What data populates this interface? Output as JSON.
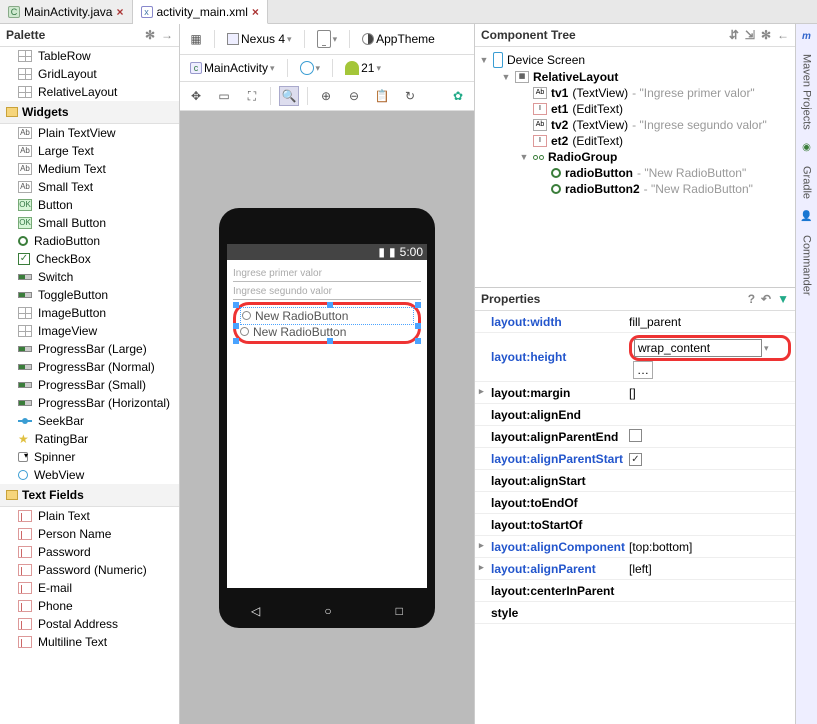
{
  "tabs": [
    {
      "label": "MainActivity.java",
      "active": false
    },
    {
      "label": "activity_main.xml",
      "active": true
    }
  ],
  "palette": {
    "title": "Palette",
    "groups": [
      {
        "type": "item",
        "icon": "grid",
        "label": "TableRow"
      },
      {
        "type": "item",
        "icon": "grid",
        "label": "GridLayout"
      },
      {
        "type": "item",
        "icon": "grid",
        "label": "RelativeLayout"
      },
      {
        "type": "cat",
        "label": "Widgets"
      },
      {
        "type": "item",
        "icon": "ab",
        "label": "Plain TextView"
      },
      {
        "type": "item",
        "icon": "ab",
        "label": "Large Text"
      },
      {
        "type": "item",
        "icon": "ab",
        "label": "Medium Text"
      },
      {
        "type": "item",
        "icon": "ab",
        "label": "Small Text"
      },
      {
        "type": "item",
        "icon": "ok",
        "label": "Button"
      },
      {
        "type": "item",
        "icon": "ok",
        "label": "Small Button"
      },
      {
        "type": "item",
        "icon": "radio",
        "label": "RadioButton"
      },
      {
        "type": "item",
        "icon": "check",
        "label": "CheckBox"
      },
      {
        "type": "item",
        "icon": "prog",
        "label": "Switch"
      },
      {
        "type": "item",
        "icon": "prog",
        "label": "ToggleButton"
      },
      {
        "type": "item",
        "icon": "grid",
        "label": "ImageButton"
      },
      {
        "type": "item",
        "icon": "grid",
        "label": "ImageView"
      },
      {
        "type": "item",
        "icon": "prog",
        "label": "ProgressBar (Large)"
      },
      {
        "type": "item",
        "icon": "prog",
        "label": "ProgressBar (Normal)"
      },
      {
        "type": "item",
        "icon": "prog",
        "label": "ProgressBar (Small)"
      },
      {
        "type": "item",
        "icon": "prog",
        "label": "ProgressBar (Horizontal)"
      },
      {
        "type": "item",
        "icon": "seek",
        "label": "SeekBar"
      },
      {
        "type": "item",
        "icon": "star",
        "label": "RatingBar"
      },
      {
        "type": "item",
        "icon": "spin",
        "label": "Spinner"
      },
      {
        "type": "item",
        "icon": "web",
        "label": "WebView"
      },
      {
        "type": "cat",
        "label": "Text Fields"
      },
      {
        "type": "item",
        "icon": "txt",
        "label": "Plain Text"
      },
      {
        "type": "item",
        "icon": "txt",
        "label": "Person Name"
      },
      {
        "type": "item",
        "icon": "txt",
        "label": "Password"
      },
      {
        "type": "item",
        "icon": "txt",
        "label": "Password (Numeric)"
      },
      {
        "type": "item",
        "icon": "txt",
        "label": "E-mail"
      },
      {
        "type": "item",
        "icon": "txt",
        "label": "Phone"
      },
      {
        "type": "item",
        "icon": "txt",
        "label": "Postal Address"
      },
      {
        "type": "item",
        "icon": "txt",
        "label": "Multiline Text"
      }
    ]
  },
  "toolbar": {
    "device": "Nexus 4",
    "theme": "AppTheme",
    "activity": "MainActivity",
    "api": "21"
  },
  "device_preview": {
    "status_time": "5:00",
    "hint1": "Ingrese primer valor",
    "hint2": "Ingrese segundo valor",
    "radio1": "New RadioButton",
    "radio2": "New RadioButton"
  },
  "component_tree": {
    "title": "Component Tree",
    "root": "Device Screen",
    "items": [
      {
        "depth": 1,
        "icon": "rel",
        "name": "RelativeLayout",
        "extra": ""
      },
      {
        "depth": 2,
        "icon": "ab",
        "name": "tv1",
        "type": "(TextView)",
        "extra": "- \"Ingrese primer valor\""
      },
      {
        "depth": 2,
        "icon": "txt",
        "name": "et1",
        "type": "(EditText)",
        "extra": ""
      },
      {
        "depth": 2,
        "icon": "ab",
        "name": "tv2",
        "type": "(TextView)",
        "extra": "- \"Ingrese segundo valor\""
      },
      {
        "depth": 2,
        "icon": "txt",
        "name": "et2",
        "type": "(EditText)",
        "extra": ""
      },
      {
        "depth": 2,
        "icon": "rg",
        "name": "RadioGroup",
        "type": "",
        "extra": ""
      },
      {
        "depth": 3,
        "icon": "rb",
        "name": "radioButton",
        "type": "",
        "extra": "- \"New RadioButton\""
      },
      {
        "depth": 3,
        "icon": "rb",
        "name": "radioButton2",
        "type": "",
        "extra": "- \"New RadioButton\""
      }
    ]
  },
  "properties": {
    "title": "Properties",
    "rows": [
      {
        "key": "layout:width",
        "blue": true,
        "val": "fill_parent",
        "highlight": false
      },
      {
        "key": "layout:height",
        "blue": true,
        "val": "wrap_content",
        "highlight": true,
        "ellipsis": true
      },
      {
        "key": "layout:margin",
        "blue": false,
        "bold": true,
        "val": "[]",
        "expand": true
      },
      {
        "key": "layout:alignEnd",
        "blue": false,
        "bold": true,
        "val": ""
      },
      {
        "key": "layout:alignParentEnd",
        "blue": false,
        "bold": true,
        "val": "",
        "checkbox": false
      },
      {
        "key": "layout:alignParentStart",
        "blue": true,
        "bold": true,
        "val": "",
        "checkbox": true
      },
      {
        "key": "layout:alignStart",
        "blue": false,
        "bold": true,
        "val": ""
      },
      {
        "key": "layout:toEndOf",
        "blue": false,
        "bold": true,
        "val": ""
      },
      {
        "key": "layout:toStartOf",
        "blue": false,
        "bold": true,
        "val": ""
      },
      {
        "key": "layout:alignComponent",
        "blue": true,
        "bold": true,
        "val": "[top:bottom]",
        "expand": true
      },
      {
        "key": "layout:alignParent",
        "blue": true,
        "bold": true,
        "val": "[left]",
        "expand": true
      },
      {
        "key": "layout:centerInParent",
        "blue": false,
        "bold": true,
        "val": ""
      },
      {
        "key": "style",
        "blue": false,
        "bold": true,
        "val": ""
      }
    ]
  },
  "rail": {
    "m": "m",
    "projects": "Maven Projects",
    "gradle": "Gradle",
    "commander": "Commander"
  }
}
